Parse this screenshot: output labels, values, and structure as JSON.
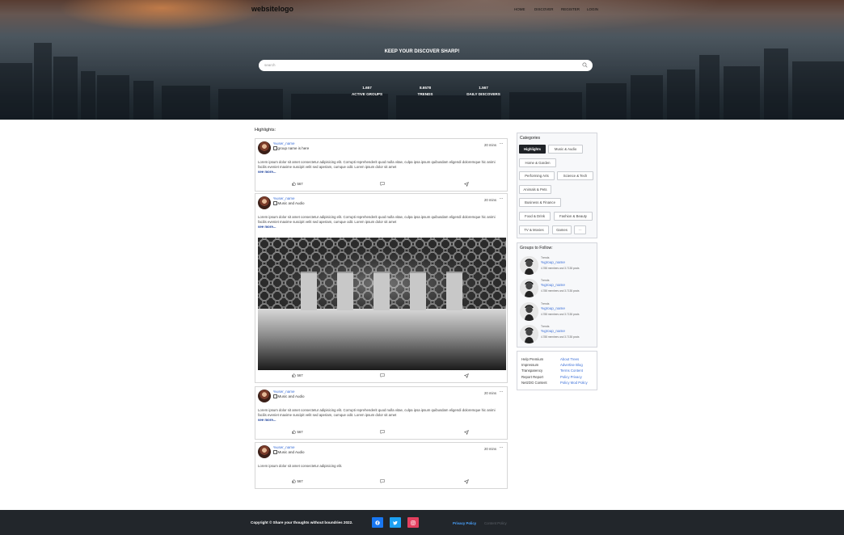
{
  "header": {
    "logo": "websitelogo",
    "nav": [
      "HOME",
      "DISCOVER",
      "REGISTER",
      "LOGIN"
    ],
    "hero_title": "KEEP YOUR DISCOVER SHARP!",
    "search_placeholder": "search",
    "stats": [
      {
        "value": "1.657",
        "label": "ACTIVE GROUPS"
      },
      {
        "value": "8.6578",
        "label": "TRENDS"
      },
      {
        "value": "1.567",
        "label": "DAILY DISCOVERS"
      }
    ]
  },
  "main": {
    "highlights_label": "Highlights:",
    "posts": [
      {
        "user": "%user_name",
        "group": "group name is here",
        "time": "20 mins",
        "more": "···",
        "text": "Lorem ipsum dolor sit amet consectetur adipisicing elit. Corrupti reprehenderit quod nulla vitae, culpa ipsa ipsum quibusdam eligendi doloremque hic animi facilis eveniet maxime suscipit velit sed aperiam, cumque odit. Lorem ipsum dolor sit amet",
        "see_more": "see more...",
        "likes": "567"
      },
      {
        "user": "%user_name",
        "group": "Music and Audio",
        "time": "20 mins",
        "more": "···",
        "text": "Lorem ipsum dolor sit amet consectetur adipisicing elit. Corrupti reprehenderit quod nulla vitae, culpa ipsa ipsum quibusdam eligendi doloremque hic animi facilis eveniet maxime suscipit velit sed aperiam, cumque odit. Lorem ipsum dolor sit amet",
        "see_more": "see more...",
        "likes": "567",
        "image": "doors-room-photo"
      },
      {
        "user": "%user_name",
        "group": "Music and Audio",
        "time": "20 mins",
        "more": "···",
        "text": "Lorem ipsum dolor sit amet consectetur adipisicing elit. Corrupti reprehenderit quod nulla vitae, culpa ipsa ipsum quibusdam eligendi doloremque hic animi facilis eveniet maxime suscipit velit sed aperiam, cumque odit. Lorem ipsum dolor sit amet",
        "see_more": "see more...",
        "likes": "567"
      },
      {
        "user": "%user_name",
        "group": "Music and Audio",
        "time": "20 mins",
        "more": "···",
        "text": "Lorem ipsum dolor sit amet consectetur adipisicing elit.",
        "likes": "567"
      }
    ]
  },
  "sidebar": {
    "categories_title": "Categories",
    "categories": [
      "Highlights",
      "Music & Audio",
      "Home & Garden",
      "Performing Arts",
      "Science & Tech",
      "Animals & Pets",
      "Business & Finance",
      "Food & Drink",
      "Fashion & Beauty",
      "TV & Movies",
      "Games",
      "···"
    ],
    "groups_title": "Groups to Follow:",
    "groups": [
      {
        "label": "Trends",
        "name": "%group_name",
        "meta": "4.788 members and 3.7138 posts"
      },
      {
        "label": "Trends",
        "name": "%group_name",
        "meta": "4.788 members and 3.7138 posts"
      },
      {
        "label": "Trends",
        "name": "%group_name",
        "meta": "4.788 members and 3.7138 posts"
      },
      {
        "label": "Trends",
        "name": "%group_name",
        "meta": "4.788 members and 3.7138 posts"
      }
    ],
    "links_left": [
      "Help Premium",
      "Impressum",
      "Transparency",
      "Report Report",
      "NetzDG Content"
    ],
    "links_right": [
      "About Trees",
      "Advertise Blog",
      "Terms Content",
      "Policy Privacy",
      "Policy Mod Policy"
    ]
  },
  "footer": {
    "copyright": "Copyright © Share your thoughts without boundries 2022.",
    "privacy": "Privacy Policy",
    "content_policy": "Content Policy",
    "social": [
      {
        "name": "facebook-icon",
        "color": "#1877f2"
      },
      {
        "name": "twitter-icon",
        "color": "#1da1f2"
      },
      {
        "name": "instagram-icon",
        "color": "#e4405f"
      }
    ]
  }
}
